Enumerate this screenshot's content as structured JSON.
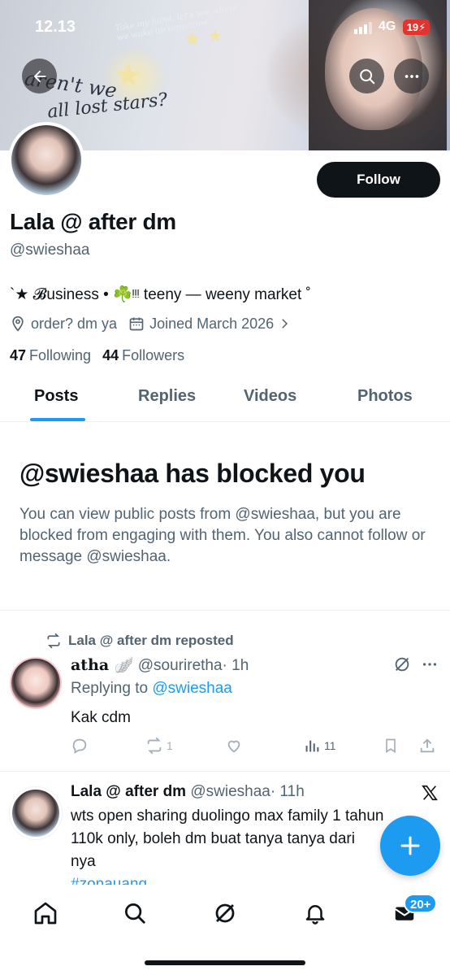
{
  "status_bar": {
    "time": "12.13",
    "network": "4G",
    "battery": "19"
  },
  "banner": {
    "text_line1": "aren't we",
    "text_line2": "all lost stars?",
    "small_text": "Take my hand, let's see where we wake up tomorrow"
  },
  "profile": {
    "display_name": "Lala @ after dm",
    "handle": "@swieshaa",
    "bio": "`★ 𝓑usiness • ☘️ᵎᵎᵎ teeny — weeny market ˚",
    "location": "order? dm ya",
    "joined": "Joined March 2026",
    "following_count": "47",
    "following_label": "Following",
    "followers_count": "44",
    "followers_label": "Followers",
    "follow_label": "Follow"
  },
  "tabs": [
    {
      "label": "Posts",
      "active": true
    },
    {
      "label": "Replies",
      "active": false
    },
    {
      "label": "Videos",
      "active": false
    },
    {
      "label": "Photos",
      "active": false
    }
  ],
  "blocked": {
    "title": "@swieshaa has blocked you",
    "description": "You can view public posts from @swieshaa, but you are blocked from engaging with them. You also cannot follow or message @swieshaa."
  },
  "posts": [
    {
      "repost_label": "Lala @ after dm reposted",
      "name": "atha 🪽",
      "handle": "@souriretha",
      "time": "· 1h",
      "replying_prefix": "Replying to",
      "replying_to": "@swieshaa",
      "text": "Kak cdm",
      "retweets": "1",
      "views": "11"
    },
    {
      "name": "Lala @ after dm",
      "handle": "@swieshaa",
      "time": "· 11h",
      "text_line1": "wts open sharing duolingo max family 1 tahun",
      "text_line2": "110k only, boleh dm buat tanya tanya dari",
      "text_line3": "nya",
      "hashtag": "#zonauang"
    }
  ],
  "nav": {
    "messages_badge": "20+"
  },
  "colors": {
    "accent": "#1d9bf0",
    "text": "#0f1419",
    "muted": "#536471",
    "battery": "#e0342f"
  }
}
